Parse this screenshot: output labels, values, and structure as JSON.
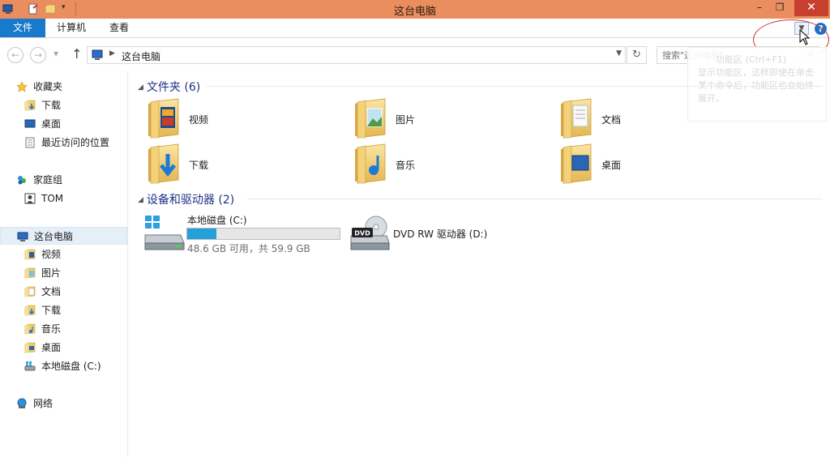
{
  "window": {
    "title": "这台电脑",
    "minimize": "–",
    "maximize": "❐",
    "close": "✕"
  },
  "ribbon": {
    "tabs": [
      "文件",
      "计算机",
      "查看"
    ],
    "help": "?"
  },
  "navigation": {
    "address": "这台电脑",
    "search_placeholder": "搜索\"这台电脑\""
  },
  "tooltip": {
    "title": "功能区 (Ctrl+F1)",
    "body": "显示功能区，这样即使在单击某个命令后，功能区也会始终展开。"
  },
  "sidebar": {
    "favorites": {
      "label": "收藏夹",
      "items": [
        "下载",
        "桌面",
        "最近访问的位置"
      ]
    },
    "homegroup": {
      "label": "家庭组",
      "items": [
        "TOM"
      ]
    },
    "thispc": {
      "label": "这台电脑",
      "items": [
        "视频",
        "图片",
        "文档",
        "下载",
        "音乐",
        "桌面",
        "本地磁盘 (C:)"
      ]
    },
    "network": {
      "label": "网络"
    }
  },
  "content": {
    "folders_header": "文件夹 (6)",
    "folders": [
      "视频",
      "图片",
      "文档",
      "下载",
      "音乐",
      "桌面"
    ],
    "devices_header": "设备和驱动器 (2)",
    "drives": [
      {
        "name": "本地磁盘 (C:)",
        "free_text": "48.6 GB 可用，共 59.9 GB",
        "used_fraction": 0.19
      },
      {
        "name": "DVD RW 驱动器 (D:)",
        "badge": "DVD"
      }
    ]
  },
  "colors": {
    "titlebar": "#eb8e5f",
    "file_tab": "#1979ca",
    "header_text": "#1e3287",
    "drive_bar": "#26a0da",
    "highlight_circle": "#d23333"
  }
}
